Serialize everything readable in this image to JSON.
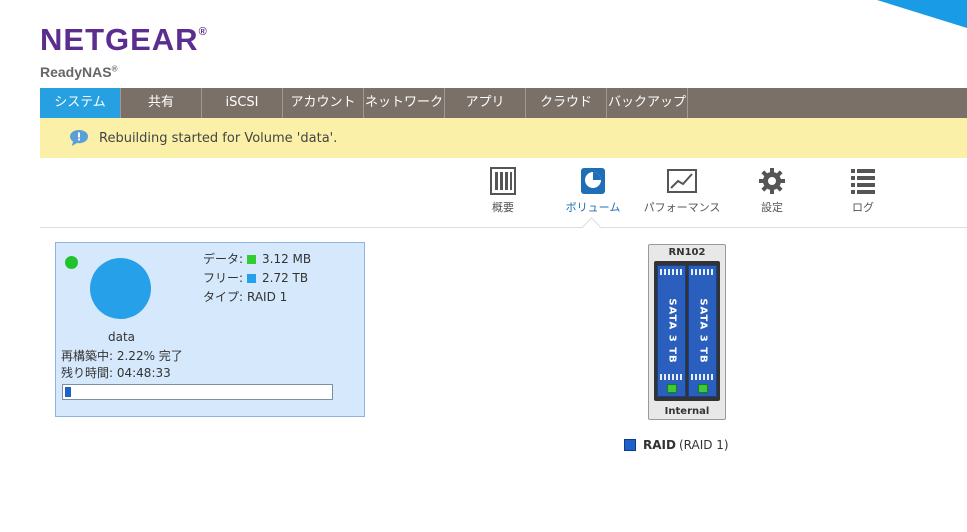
{
  "brand": {
    "logo": "NETGEAR",
    "product": "ReadyNAS",
    "reg": "®",
    "accent": "#26a0e0"
  },
  "tabs": [
    {
      "label": "システム",
      "active": true
    },
    {
      "label": "共有"
    },
    {
      "label": "iSCSI"
    },
    {
      "label": "アカウント"
    },
    {
      "label": "ネットワーク"
    },
    {
      "label": "アプリ"
    },
    {
      "label": "クラウド"
    },
    {
      "label": "バックアップ"
    }
  ],
  "notice": {
    "icon": "speech-bubble-icon",
    "text": "Rebuilding started for Volume 'data'."
  },
  "subnav": [
    {
      "label": "概要",
      "icon": "overview-icon"
    },
    {
      "label": "ボリューム",
      "icon": "volume-icon",
      "active": true
    },
    {
      "label": "パフォーマンス",
      "icon": "performance-icon"
    },
    {
      "label": "設定",
      "icon": "gear-icon"
    },
    {
      "label": "ログ",
      "icon": "list-icon"
    }
  ],
  "volume": {
    "name": "data",
    "status_color": "#22c32a",
    "data_label": "データ:",
    "data_value": "3.12 MB",
    "data_color": "#33cc33",
    "free_label": "フリー:",
    "free_value": "2.72 TB",
    "free_color": "#26a0e8",
    "type_label": "タイプ:",
    "type_value": "RAID 1",
    "rebuild_text": "再構築中: 2.22% 完了",
    "remaining_text": "残り時間: 04:48:33",
    "progress": 0.0222
  },
  "nas": {
    "model": "RN102",
    "drives": [
      {
        "label": "SATA 3 TB"
      },
      {
        "label": "SATA 3 TB"
      }
    ],
    "footer": "Internal"
  },
  "raid_legend": {
    "name": "RAID",
    "level": "(RAID 1)"
  }
}
